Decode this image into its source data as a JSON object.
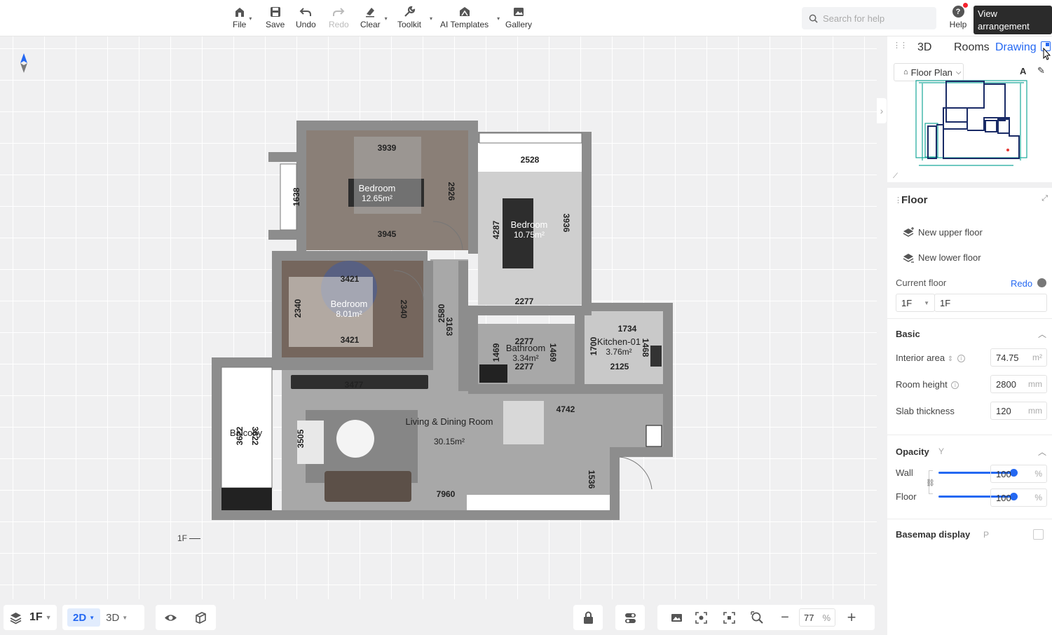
{
  "toolbar": {
    "items": [
      {
        "label": "File",
        "icon": "home-icon"
      },
      {
        "label": "Save",
        "icon": "save-icon"
      },
      {
        "label": "Undo",
        "icon": "undo-icon"
      },
      {
        "label": "Redo",
        "icon": "redo-icon"
      },
      {
        "label": "Clear",
        "icon": "clear-icon"
      },
      {
        "label": "Toolkit",
        "icon": "wrench-icon"
      },
      {
        "label": "AI Templates",
        "icon": "ai-templates-icon"
      },
      {
        "label": "Gallery",
        "icon": "gallery-icon"
      }
    ],
    "search_placeholder": "Search for help",
    "help_label": "Help",
    "help_glyph": "?",
    "tooltip": "View arrangement"
  },
  "canvas": {
    "floor_marker": "1F",
    "rooms": [
      {
        "name": "Bedroom",
        "area": "12.65m²"
      },
      {
        "name": "Bedroom",
        "area": "10.75m²"
      },
      {
        "name": "Bedroom",
        "area": "8.01m²"
      },
      {
        "name": "Bathroom",
        "area": "3.34m²"
      },
      {
        "name": "Kitchen-01",
        "area": "3.76m²"
      },
      {
        "name": "Living & Dining Room",
        "area": "30.15m²"
      },
      {
        "name": "Balcony",
        "area": ""
      }
    ],
    "dims": [
      "3939",
      "3945",
      "1638",
      "2926",
      "2528",
      "4287",
      "3936",
      "2277",
      "3421",
      "3421",
      "2340",
      "2340",
      "2580",
      "3163",
      "2277",
      "2277",
      "1469",
      "1469",
      "1734",
      "2125",
      "1700",
      "1468",
      "3477",
      "4742",
      "3505",
      "7960",
      "1536",
      "3622",
      "3622"
    ]
  },
  "bottom": {
    "floor": "1F",
    "view2d": "2D",
    "view3d": "3D",
    "zoom_value": "77",
    "zoom_unit": "%",
    "zoom_minus": "−",
    "zoom_plus": "+"
  },
  "panel": {
    "tabs": [
      "3D",
      "Rooms",
      "Drawing"
    ],
    "active_tab": "Drawing",
    "floor_plan_select": "Floor Plan",
    "title": "Floor",
    "new_upper": "New upper floor",
    "new_lower": "New lower floor",
    "current_floor_label": "Current floor",
    "current_floor_action": "Redo",
    "current_floor_level": "1F",
    "current_floor_name": "1F",
    "basic_title": "Basic",
    "interior_area_label": "Interior area",
    "interior_area_value": "74.75",
    "interior_area_unit": "m²",
    "room_height_label": "Room height",
    "room_height_value": "2800",
    "room_height_unit": "mm",
    "slab_label": "Slab thickness",
    "slab_value": "120",
    "slab_unit": "mm",
    "opacity_title": "Opacity",
    "opacity_key": "Y",
    "wall_label": "Wall",
    "wall_value": "100",
    "floor_label": "Floor",
    "floor_value": "100",
    "percent": "%",
    "basemap_label": "Basemap display",
    "basemap_key": "P"
  },
  "colors": {
    "accent": "#2468f2",
    "wall": "#8d8d8d",
    "canvas": "#f0f0f1"
  }
}
